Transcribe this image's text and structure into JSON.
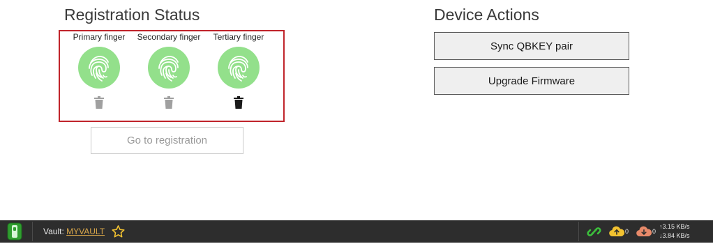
{
  "registration": {
    "title": "Registration Status",
    "fingers": [
      {
        "label": "Primary finger",
        "delete_enabled": false
      },
      {
        "label": "Secondary finger",
        "delete_enabled": false
      },
      {
        "label": "Tertiary finger",
        "delete_enabled": true
      }
    ],
    "go_button_label": "Go to registration"
  },
  "device_actions": {
    "title": "Device Actions",
    "buttons": [
      "Sync QBKEY pair",
      "Upgrade Firmware"
    ]
  },
  "statusbar": {
    "vault_label": "Vault:",
    "vault_name": "MYVAULT",
    "upload_count": "0",
    "download_count": "0",
    "upload_speed": "3.15 KB/s",
    "download_speed": "3.84 KB/s"
  },
  "colors": {
    "fingerprint_green": "#93e08b",
    "highlight_border": "#c0242b",
    "statusbar_bg": "#2d2d2d",
    "link_green": "#3cbf3c",
    "upload_yellow": "#f2c230",
    "download_salmon": "#e88a6a"
  }
}
